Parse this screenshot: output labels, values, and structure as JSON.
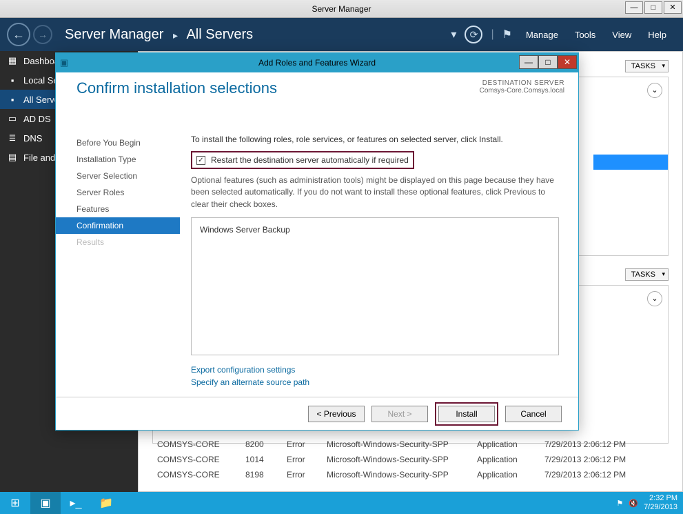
{
  "window": {
    "title": "Server Manager"
  },
  "topnav": {
    "breadcrumb1": "Server Manager",
    "breadcrumb2": "All Servers",
    "menu": {
      "manage": "Manage",
      "tools": "Tools",
      "view": "View",
      "help": "Help"
    }
  },
  "sidebar": {
    "items": [
      {
        "icon": "▦",
        "label": "Dashboard"
      },
      {
        "icon": "▪",
        "label": "Local Server"
      },
      {
        "icon": "▪",
        "label": "All Servers",
        "active": true
      },
      {
        "icon": "▭",
        "label": "AD DS"
      },
      {
        "icon": "≣",
        "label": "DNS"
      },
      {
        "icon": "▤",
        "label": "File and Storage Services"
      }
    ]
  },
  "panels": {
    "tasks_label": "TASKS",
    "blue_tab": "on"
  },
  "events": [
    {
      "server": "COMSYS-CORE",
      "id": "8200",
      "level": "Error",
      "source": "Microsoft-Windows-Security-SPP",
      "log": "Application",
      "datetime": "7/29/2013 2:06:12 PM"
    },
    {
      "server": "COMSYS-CORE",
      "id": "1014",
      "level": "Error",
      "source": "Microsoft-Windows-Security-SPP",
      "log": "Application",
      "datetime": "7/29/2013 2:06:12 PM"
    },
    {
      "server": "COMSYS-CORE",
      "id": "8198",
      "level": "Error",
      "source": "Microsoft-Windows-Security-SPP",
      "log": "Application",
      "datetime": "7/29/2013 2:06:12 PM"
    }
  ],
  "wizard": {
    "title": "Add Roles and Features Wizard",
    "heading": "Confirm installation selections",
    "dest_label": "DESTINATION SERVER",
    "dest_server": "Comsys-Core.Comsys.local",
    "steps": [
      "Before You Begin",
      "Installation Type",
      "Server Selection",
      "Server Roles",
      "Features",
      "Confirmation",
      "Results"
    ],
    "intro": "To install the following roles, role services, or features on selected server, click Install.",
    "restart_label": "Restart the destination server automatically if required",
    "note": "Optional features (such as administration tools) might be displayed on this page because they have been selected automatically. If you do not want to install these optional features, click Previous to clear their check boxes.",
    "selected_feature": "Windows Server Backup",
    "link_export": "Export configuration settings",
    "link_altpath": "Specify an alternate source path",
    "btn_prev": "< Previous",
    "btn_next": "Next >",
    "btn_install": "Install",
    "btn_cancel": "Cancel"
  },
  "taskbar": {
    "time": "2:32 PM",
    "date": "7/29/2013"
  }
}
